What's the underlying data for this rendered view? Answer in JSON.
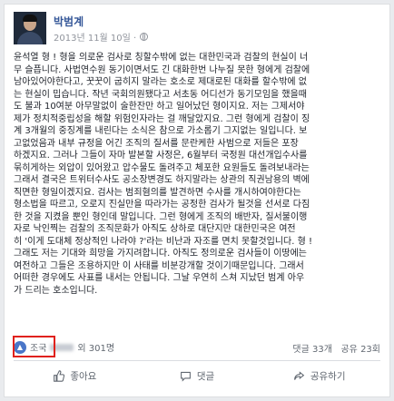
{
  "post": {
    "author": "박범계",
    "date": "2013년 11월 10일 ·",
    "body_lines": [
      "윤석열 형 ! 형을 의로운 검사로 칭할수밖에 없는 대한민국과 검찰의 현실이 너",
      "무 슬픕니다. 사법연수원 동기이면서도 긴 대화한번 나누질 못한 형에게 검찰에",
      "남아있어야한다고, 꿋꿋이 굽히지 말라는 호소로 제대로된 대화를 할수밖에 없",
      "는 현실이 밉습니다. 작년 국회의원됐다고 서초동 어디선가 동기모임을 했을때",
      "도 불과 10여분 아무말없이 술한잔만 하고 일어났던 형이지요. 저는 그제서야",
      "제가 정치적중립성을 해할 위험인자라는 걸 깨달았지요. 그런 형에게 검찰이 징",
      "계 3개월의 중징계를 내린다는 소식은 참으로 가소롭기 그지없는 일입니다. 보",
      "고없었음과 내부 규정을 어긴 조직의 질서를 문란케한 사범으로 저들은 포장",
      "하겠지요. 그러나 그들이 자마 발본할 사정은, 6월부터 국정원 대선개입수사를",
      "묶히게하는 외압이 있어왔고 압수물도 돌려주고 체포한 요원들도 돌려보내라는",
      "그래서 결국은 트위터수사도 공소장변경도 하지말라는 상관의 직권남용의 벽에",
      "직면한 형일이겠지요. 검사는 범죄혐의를 발견하면 수사를 개시하여야한다는",
      "형소법을 따르고, 오로지 진실만을 따라가는 공정한 검사가 될것을 선서로 다짐",
      "한 것을 지켰을 뿐인 형인데 말입니다. 그런 형에게 조직의 배반자, 질서불이행",
      "자로 낙인찍는 검찰의 조직문화가 아직도 상하로 대단지만 대한민국은 여전",
      "히 '이게 도대체 정상적인 나라야 ?'라는 비난과 자조를 면치 못할것입니다. 형 !",
      "그래도 저는 기대와 희망을 가지려합니다. 아직도 정의로운 검사들이 이땅에는",
      "여전하고 그들은 조용하지만 이 사태를 비분강개할 것이기때문입니다. 그래서",
      "어떠한 경우에도 사표를 내서는 안됩니다. 그날 우연히 스쳐 지났던 범계 아우",
      "가 드리는 호소입니다."
    ]
  },
  "stats": {
    "reaction_prefix": "조국",
    "reaction_suffix": "외 301명",
    "comments": "댓글 33개",
    "shares": "공유 23회"
  },
  "actions": {
    "like": "좋아요",
    "comment": "댓글",
    "share": "공유하기"
  },
  "colors": {
    "author": "#365899",
    "highlight": "#e0211c",
    "like_badge": "#4a76c8"
  }
}
